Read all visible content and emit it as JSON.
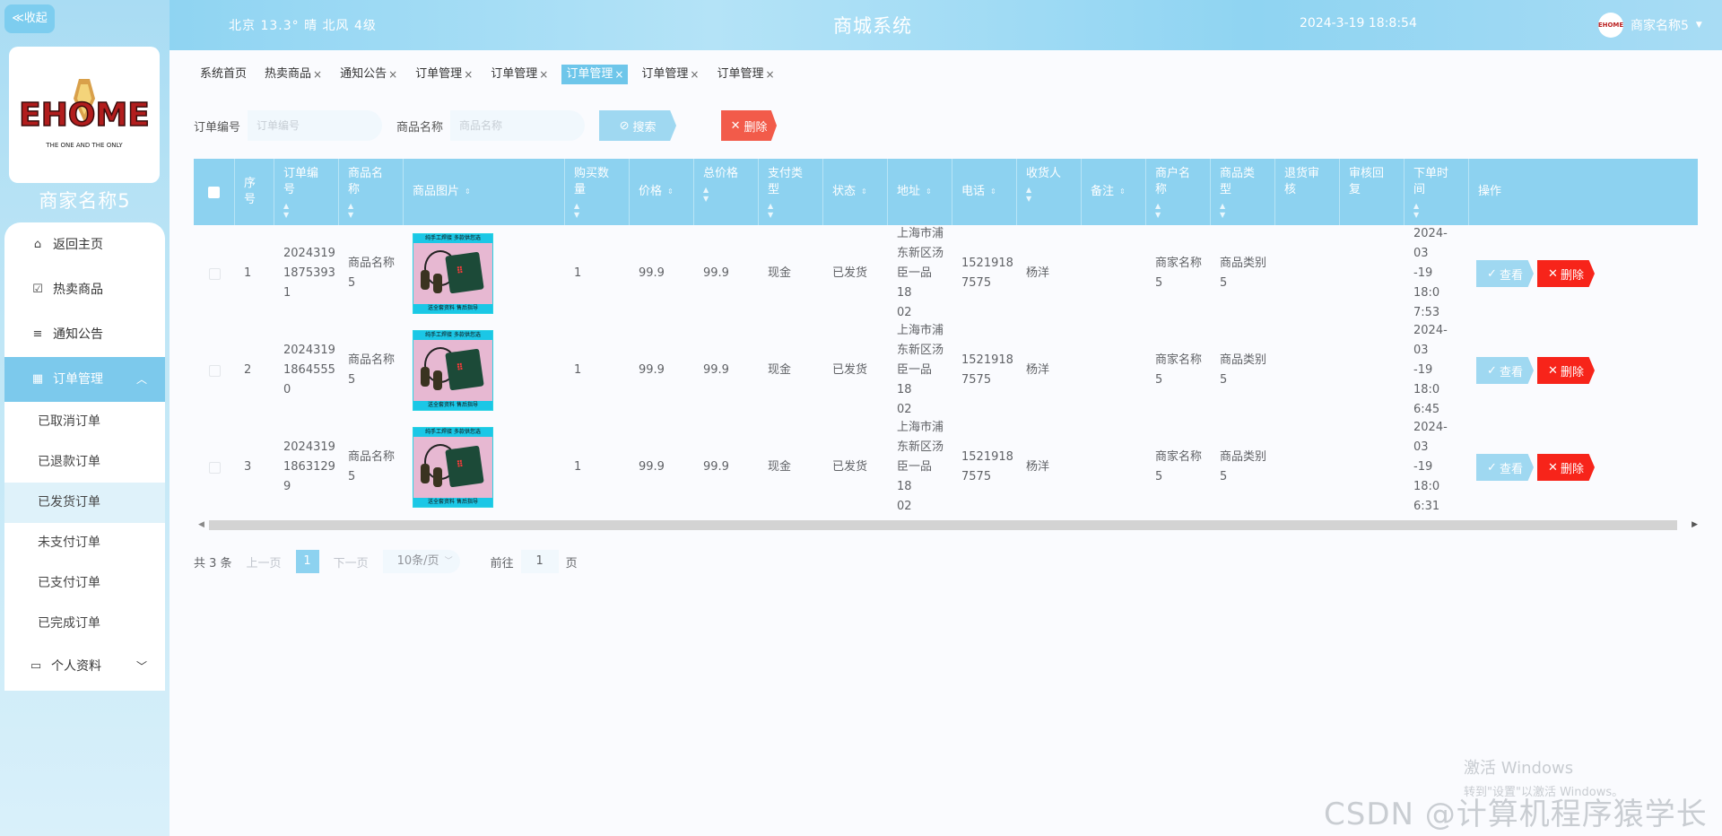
{
  "sidebar": {
    "collapse_label": "≪收起",
    "shop_name": "商家名称5",
    "logo_text": "EHOME",
    "logo_subtext": "THE ONE AND THE ONLY",
    "menu": [
      {
        "label": "返回主页",
        "icon": "home-icon"
      },
      {
        "label": "热卖商品",
        "icon": "check-square-icon"
      },
      {
        "label": "通知公告",
        "icon": "list-icon"
      },
      {
        "label": "订单管理",
        "icon": "grid-icon",
        "expanded": true
      }
    ],
    "order_submenu": [
      "已取消订单",
      "已退款订单",
      "已发货订单",
      "未支付订单",
      "已支付订单",
      "已完成订单"
    ],
    "active_submenu": "已发货订单",
    "profile_label": "个人资料"
  },
  "header": {
    "weather": "北京  13.3°  晴  北风  4级",
    "title": "商城系统",
    "datetime": "2024-3-19 18:8:54",
    "user_name": "商家名称5",
    "user_dropdown_icon": "caret-down-icon"
  },
  "tabs": [
    {
      "label": "系统首页",
      "closable": false
    },
    {
      "label": "热卖商品",
      "closable": true
    },
    {
      "label": "通知公告",
      "closable": true
    },
    {
      "label": "订单管理",
      "closable": true
    },
    {
      "label": "订单管理",
      "closable": true
    },
    {
      "label": "订单管理",
      "closable": true,
      "active": true
    },
    {
      "label": "订单管理",
      "closable": true
    },
    {
      "label": "订单管理",
      "closable": true
    }
  ],
  "search": {
    "order_no_label": "订单编号",
    "order_no_placeholder": "订单编号",
    "goods_name_label": "商品名称",
    "goods_name_placeholder": "商品名称",
    "search_button": "搜索",
    "delete_button": "删除"
  },
  "table": {
    "columns": [
      "序号",
      "订单编号",
      "商品名称",
      "商品图片",
      "购买数量",
      "价格",
      "总价格",
      "支付类型",
      "状态",
      "地址",
      "电话",
      "收货人",
      "备注",
      "商户名称",
      "商品类型",
      "退货审核",
      "审核回复",
      "下单时间",
      "操作"
    ],
    "rows": [
      {
        "index": "1",
        "order_no": "20243191875393 1",
        "goods_name": "商品名称5",
        "qty": "1",
        "price": "99.9",
        "total": "99.9",
        "pay_type": "现金",
        "status": "已发货",
        "address": "上海市浦东新区汤臣一品1802",
        "phone": "15219187575",
        "receiver": "杨洋",
        "remark": "",
        "merchant": "商家名称5",
        "goods_type": "商品类别5",
        "return_audit": "",
        "audit_reply": "",
        "order_time": "2024-03-19 18:07:53"
      },
      {
        "index": "2",
        "order_no": "20243191864555 0",
        "goods_name": "商品名称5",
        "qty": "1",
        "price": "99.9",
        "total": "99.9",
        "pay_type": "现金",
        "status": "已发货",
        "address": "上海市浦东新区汤臣一品1802",
        "phone": "15219187575",
        "receiver": "杨洋",
        "remark": "",
        "merchant": "商家名称5",
        "goods_type": "商品类别5",
        "return_audit": "",
        "audit_reply": "",
        "order_time": "2024-03-19 18:06:45"
      },
      {
        "index": "3",
        "order_no": "20243191863129 9",
        "goods_name": "商品名称5",
        "qty": "1",
        "price": "99.9",
        "total": "99.9",
        "pay_type": "现金",
        "status": "已发货",
        "address": "上海市浦东新区汤臣一品1802",
        "phone": "15219187575",
        "receiver": "杨洋",
        "remark": "",
        "merchant": "商家名称5",
        "goods_type": "商品类别5",
        "return_audit": "",
        "audit_reply": "",
        "order_time": "2024-03-19 18:06:31"
      }
    ],
    "row_display": [
      {
        "order_no": [
          "2024319",
          "1875393",
          "1"
        ],
        "goods_name": [
          "商品名称",
          "5"
        ],
        "address": [
          "上海市浦",
          "东新区汤",
          "臣一品18",
          "02"
        ],
        "phone": [
          "1521918",
          "7575"
        ],
        "merchant": [
          "商家名称",
          "5"
        ],
        "goods_type": [
          "商品类别",
          "5"
        ],
        "order_time": [
          "2024-03",
          "-19 18:0",
          "7:53"
        ]
      },
      {
        "order_no": [
          "2024319",
          "1864555",
          "0"
        ],
        "goods_name": [
          "商品名称",
          "5"
        ],
        "address": [
          "上海市浦",
          "东新区汤",
          "臣一品18",
          "02"
        ],
        "phone": [
          "1521918",
          "7575"
        ],
        "merchant": [
          "商家名称",
          "5"
        ],
        "goods_type": [
          "商品类别",
          "5"
        ],
        "order_time": [
          "2024-03",
          "-19 18:0",
          "6:45"
        ]
      },
      {
        "order_no": [
          "2024319",
          "1863129",
          "9"
        ],
        "goods_name": [
          "商品名称",
          "5"
        ],
        "address": [
          "上海市浦",
          "东新区汤",
          "臣一品18",
          "02"
        ],
        "phone": [
          "1521918",
          "7575"
        ],
        "merchant": [
          "商家名称",
          "5"
        ],
        "goods_type": [
          "商品类别",
          "5"
        ],
        "order_time": [
          "2024-03",
          "-19 18:0",
          "6:31"
        ]
      }
    ],
    "image_caption_top": "纯手工焊接 多款供您选",
    "image_caption_bottom": "送全套资料 售后指导",
    "view_button": "查看",
    "delete_button": "删除"
  },
  "pagination": {
    "total": "共 3 条",
    "prev": "上一页",
    "current_page": "1",
    "next": "下一页",
    "page_size": "10条/页",
    "goto_label": "前往",
    "goto_value": "1",
    "page_unit": "页"
  },
  "watermarks": {
    "windows_line1": "激活 Windows",
    "windows_line2": "转到\"设置\"以激活 Windows。",
    "csdn": "CSDN @计算机程序猿学长"
  },
  "colors": {
    "accent": "#8dd2f0",
    "delete_red": "#f7241a",
    "active_menu": "#7cc9ec"
  }
}
